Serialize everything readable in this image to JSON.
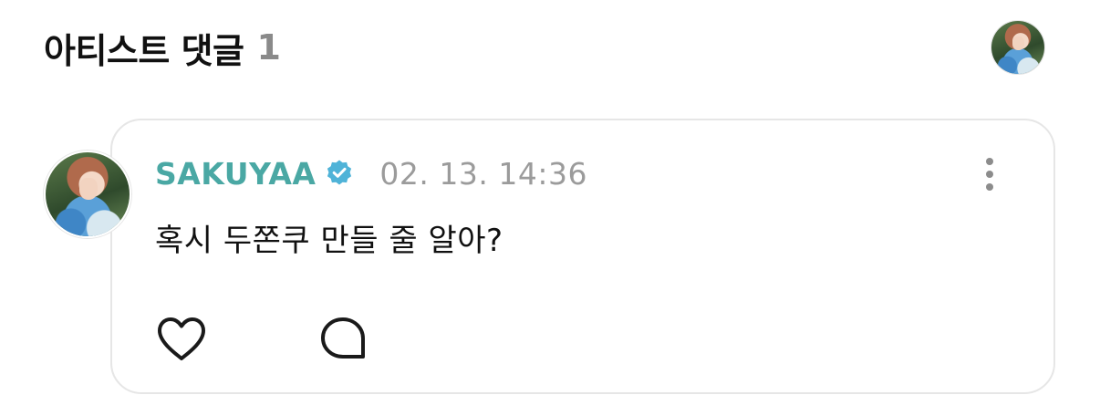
{
  "header": {
    "title": "아티스트 댓글",
    "count": "1",
    "profile_avatar": "user-avatar"
  },
  "comment": {
    "author": "SAKUYAA",
    "verified": true,
    "timestamp": "02. 13. 14:36",
    "text": "혹시 두쫀쿠 만들 줄 알아?",
    "avatar": "artist-avatar",
    "actions": {
      "like_icon": "heart-icon",
      "reply_icon": "speech-bubble-icon",
      "more_icon": "more-vertical-icon"
    }
  },
  "colors": {
    "author": "#4aa8a4",
    "verified_badge": "#4fb3d8",
    "timestamp": "#9b9b9b",
    "count": "#8a8a8a",
    "card_border": "#e6e6e6"
  }
}
